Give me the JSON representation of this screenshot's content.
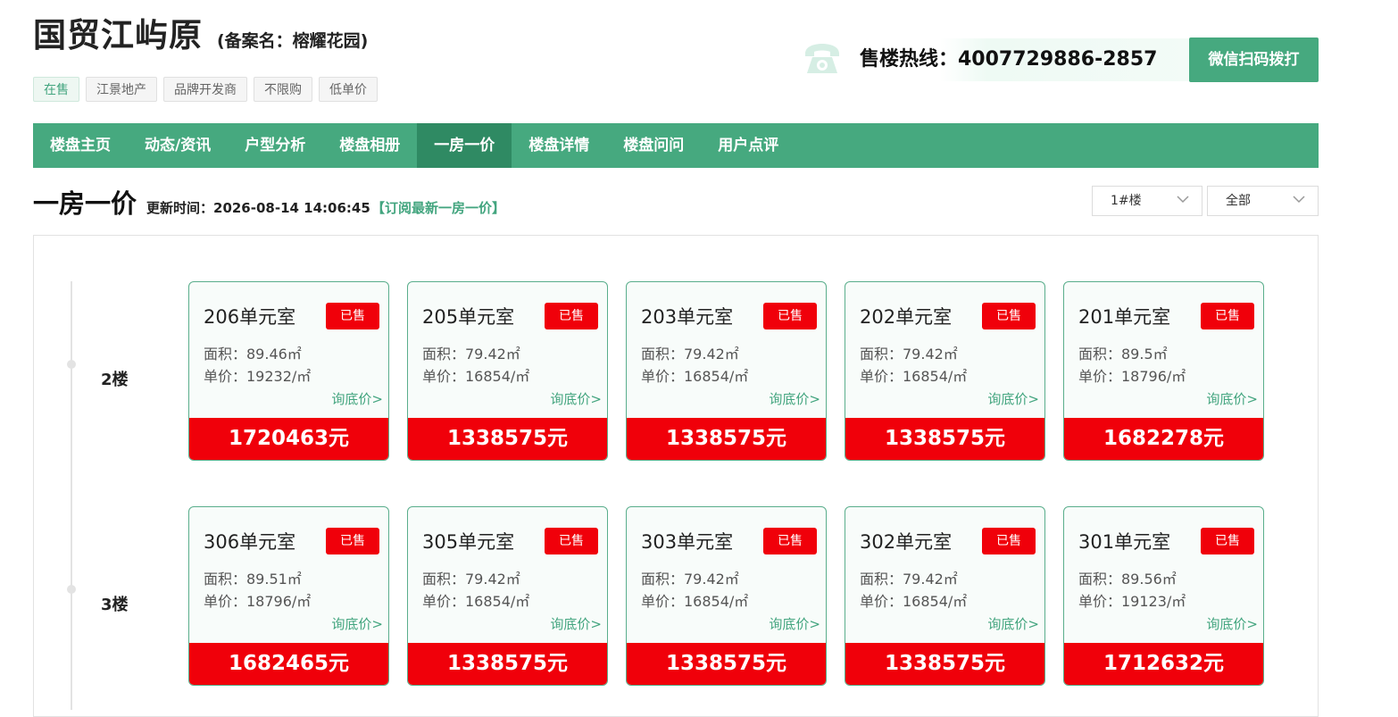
{
  "header": {
    "title": "国贸江屿原",
    "subtitle": "(备案名：榕耀花园)",
    "tags": [
      "在售",
      "江景地产",
      "品牌开发商",
      "不限购",
      "低单价"
    ],
    "hotline_text": "售楼热线：4007729886-2857",
    "wechat_button": "微信扫码拨打"
  },
  "nav": {
    "items": [
      "楼盘主页",
      "动态/资讯",
      "户型分析",
      "楼盘相册",
      "一房一价",
      "楼盘详情",
      "楼盘问问",
      "用户点评"
    ],
    "active": "一房一价"
  },
  "section": {
    "title": "一房一价",
    "update_text": "更新时间：2026-08-14 14:06:45",
    "subscribe_text": "【订阅最新一房一价】"
  },
  "filters": {
    "building": "1#楼",
    "status": "全部"
  },
  "floors": [
    {
      "label": "2楼",
      "units": [
        {
          "room": "206单元室",
          "status": "已售",
          "area": "面积：89.46㎡",
          "unit_price": "单价：19232/㎡",
          "ask": "询底价>",
          "total": "1720463元"
        },
        {
          "room": "205单元室",
          "status": "已售",
          "area": "面积：79.42㎡",
          "unit_price": "单价：16854/㎡",
          "ask": "询底价>",
          "total": "1338575元"
        },
        {
          "room": "203单元室",
          "status": "已售",
          "area": "面积：79.42㎡",
          "unit_price": "单价：16854/㎡",
          "ask": "询底价>",
          "total": "1338575元"
        },
        {
          "room": "202单元室",
          "status": "已售",
          "area": "面积：79.42㎡",
          "unit_price": "单价：16854/㎡",
          "ask": "询底价>",
          "total": "1338575元"
        },
        {
          "room": "201单元室",
          "status": "已售",
          "area": "面积：89.5㎡",
          "unit_price": "单价：18796/㎡",
          "ask": "询底价>",
          "total": "1682278元"
        }
      ]
    },
    {
      "label": "3楼",
      "units": [
        {
          "room": "306单元室",
          "status": "已售",
          "area": "面积：89.51㎡",
          "unit_price": "单价：18796/㎡",
          "ask": "询底价>",
          "total": "1682465元"
        },
        {
          "room": "305单元室",
          "status": "已售",
          "area": "面积：79.42㎡",
          "unit_price": "单价：16854/㎡",
          "ask": "询底价>",
          "total": "1338575元"
        },
        {
          "room": "303单元室",
          "status": "已售",
          "area": "面积：79.42㎡",
          "unit_price": "单价：16854/㎡",
          "ask": "询底价>",
          "total": "1338575元"
        },
        {
          "room": "302单元室",
          "status": "已售",
          "area": "面积：79.42㎡",
          "unit_price": "单价：16854/㎡",
          "ask": "询底价>",
          "total": "1338575元"
        },
        {
          "room": "301单元室",
          "status": "已售",
          "area": "面积：89.56㎡",
          "unit_price": "单价：19123/㎡",
          "ask": "询底价>",
          "total": "1712632元"
        }
      ]
    }
  ],
  "icons": {
    "phone": "phone-icon",
    "dropdown": "chevron-down-icon"
  },
  "colors": {
    "brand_green": "#46a97f",
    "active_nav": "#2f8a63",
    "sold_red": "#f0000a"
  }
}
